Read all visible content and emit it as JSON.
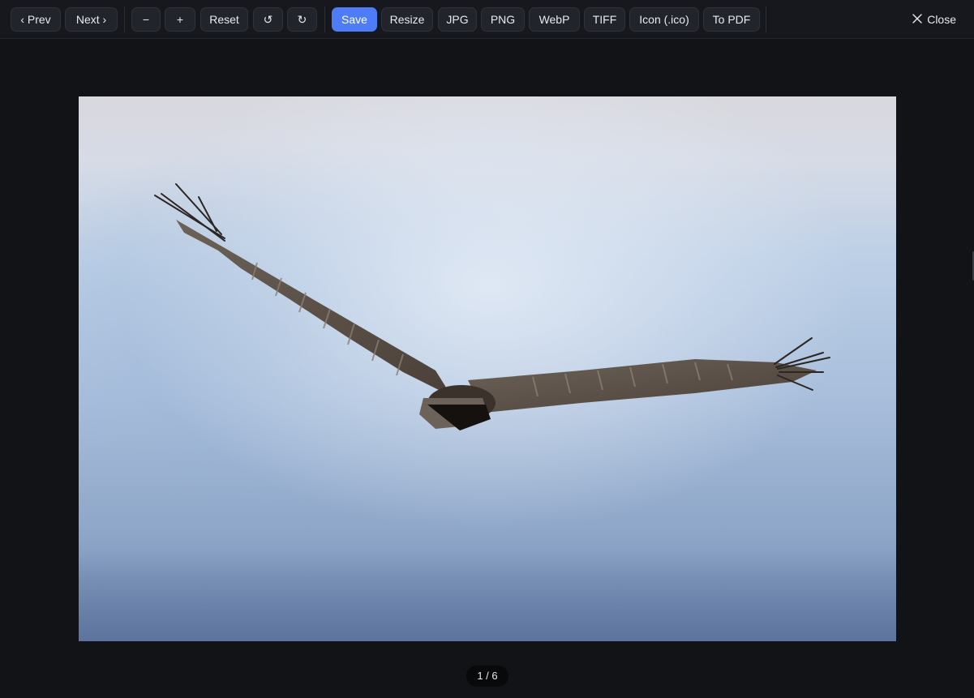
{
  "toolbar": {
    "prev_label": "‹ Prev",
    "next_label": "Next ›",
    "zoom_out_label": "−",
    "zoom_in_label": "+",
    "reset_label": "Reset",
    "rotate_left_label": "↺",
    "rotate_right_label": "↻",
    "save_label": "Save",
    "resize_label": "Resize",
    "jpg_label": "JPG",
    "png_label": "PNG",
    "webp_label": "WebP",
    "tiff_label": "TIFF",
    "ico_label": "Icon (.ico)",
    "pdf_label": "To PDF",
    "close_label": "Close"
  },
  "viewer": {
    "counter": "1 / 6",
    "image_subject": "bird in flight against blue sky"
  },
  "colors": {
    "accent": "#4e7cf6",
    "background": "#121317",
    "toolbar": "#17181d",
    "button": "#22242b"
  },
  "icons": {
    "close": "close-icon"
  }
}
